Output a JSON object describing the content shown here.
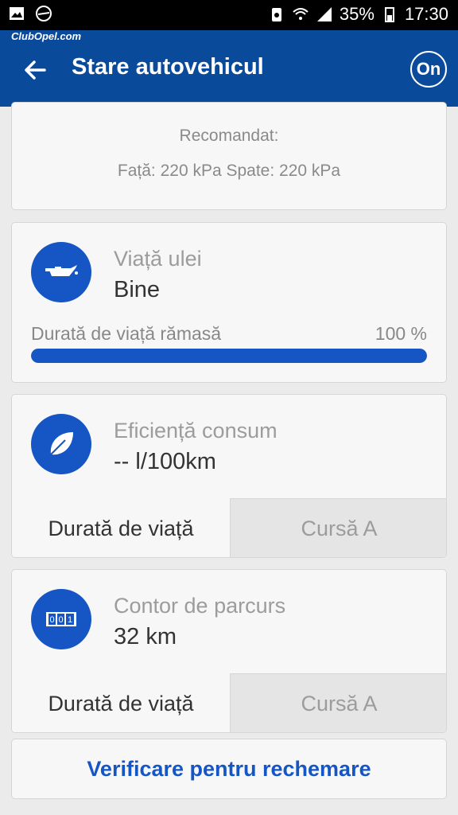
{
  "statusbar": {
    "battery": "35%",
    "time": "17:30"
  },
  "watermark": "ClubOpel.com",
  "appbar": {
    "title": "Stare autovehicul",
    "onstar_label": "On"
  },
  "tires": {
    "recommended_label": "Recomandat:",
    "pressure_text": "Față: 220 kPa Spate: 220 kPa"
  },
  "oil": {
    "label": "Viață ulei",
    "status": "Bine",
    "life_label": "Durată de viață rămasă",
    "life_percent": "100 %",
    "life_fraction": 1.0
  },
  "efficiency": {
    "label": "Eficiență consum",
    "value": "-- l/100km",
    "tab_lifetime": "Durată de viață",
    "tab_trip": "Cursă A"
  },
  "odometer": {
    "label": "Contor de parcurs",
    "value": "32 km",
    "tab_lifetime": "Durată de viață",
    "tab_trip": "Cursă A"
  },
  "recall_button": "Verificare pentru rechemare",
  "colors": {
    "appbar": "#0a4a9a",
    "accent": "#1556c4"
  }
}
